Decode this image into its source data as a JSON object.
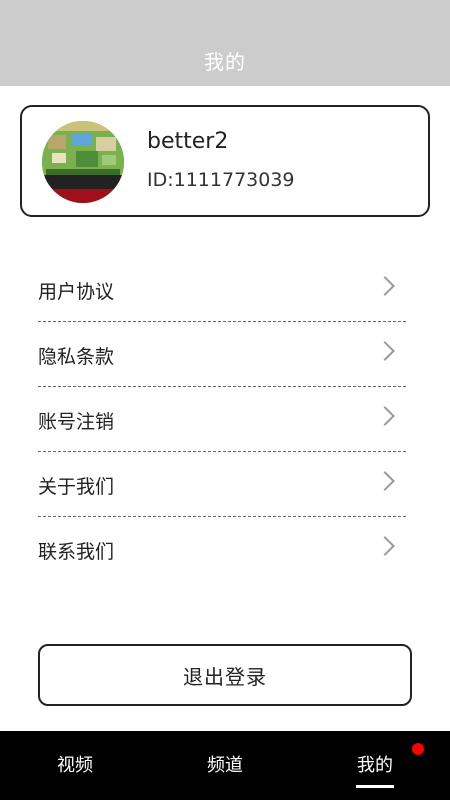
{
  "header": {
    "title": "我的"
  },
  "profile": {
    "username": "better2",
    "user_id": "ID:1111773039"
  },
  "menu": {
    "items": [
      {
        "label": "用户协议",
        "icon": "chevron-right-icon"
      },
      {
        "label": "隐私条款",
        "icon": "chevron-right-icon"
      },
      {
        "label": "账号注销",
        "icon": "chevron-right-icon"
      },
      {
        "label": "关于我们",
        "icon": "chevron-right-icon"
      },
      {
        "label": "联系我们",
        "icon": "chevron-right-icon"
      }
    ]
  },
  "logout": {
    "label": "退出登录"
  },
  "tabbar": {
    "tabs": [
      {
        "label": "视频"
      },
      {
        "label": "频道"
      },
      {
        "label": "我的",
        "active": true
      }
    ],
    "notify_color": "#ff0000"
  }
}
